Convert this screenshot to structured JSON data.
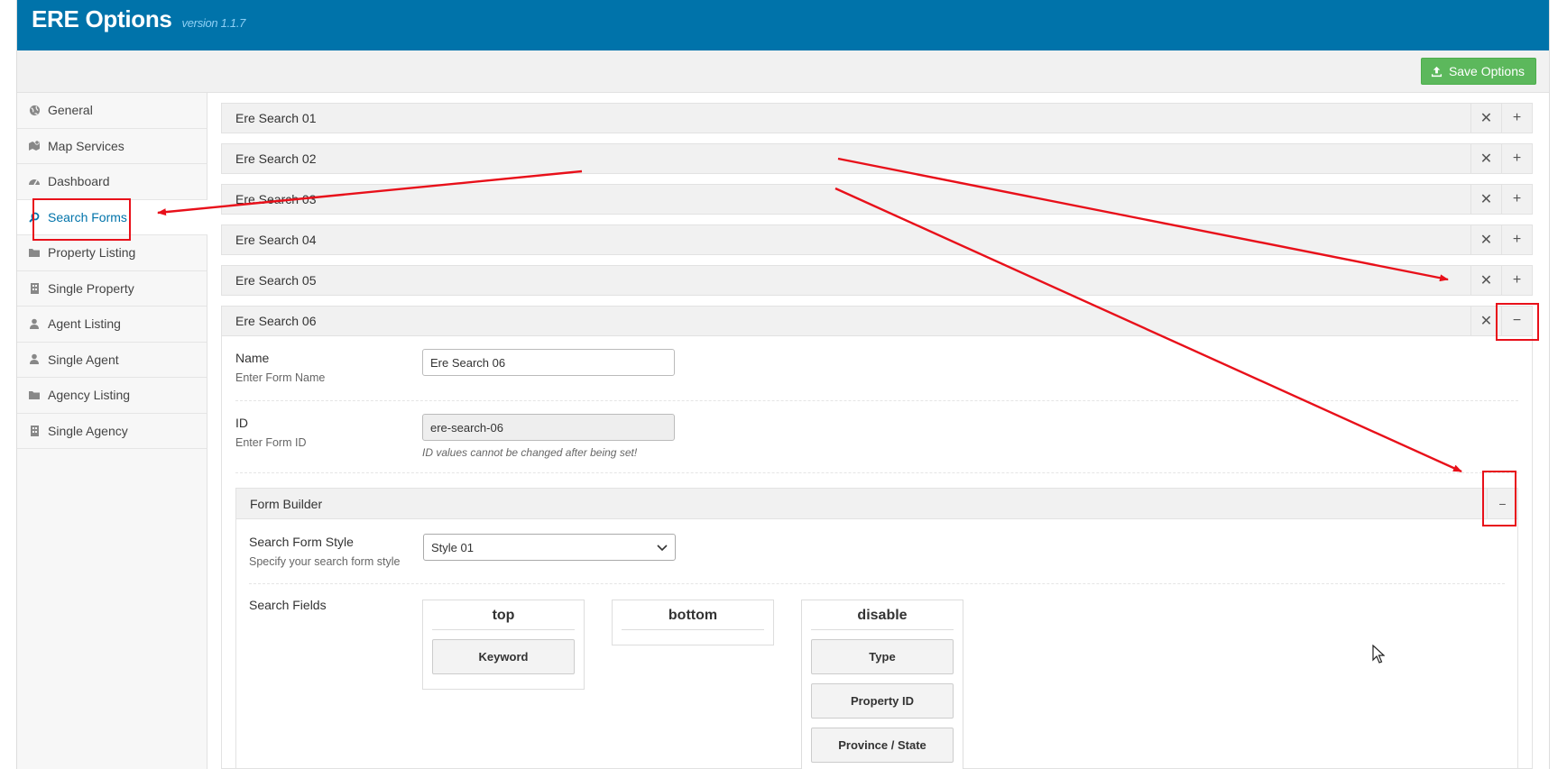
{
  "header": {
    "title": "ERE Options",
    "version": "version 1.1.7"
  },
  "toolbar": {
    "save_label": "Save Options"
  },
  "sidebar": {
    "items": [
      {
        "label": "General",
        "icon": "globe-icon"
      },
      {
        "label": "Map Services",
        "icon": "map-icon"
      },
      {
        "label": "Dashboard",
        "icon": "dashboard-icon"
      },
      {
        "label": "Search Forms",
        "icon": "search-icon",
        "active": true
      },
      {
        "label": "Property Listing",
        "icon": "folder-icon"
      },
      {
        "label": "Single Property",
        "icon": "building-icon"
      },
      {
        "label": "Agent Listing",
        "icon": "user-icon"
      },
      {
        "label": "Single Agent",
        "icon": "user-icon"
      },
      {
        "label": "Agency Listing",
        "icon": "folder-icon"
      },
      {
        "label": "Single Agency",
        "icon": "building-icon"
      }
    ]
  },
  "forms": [
    {
      "label": "Ere Search 01"
    },
    {
      "label": "Ere Search 02"
    },
    {
      "label": "Ere Search 03"
    },
    {
      "label": "Ere Search 04"
    },
    {
      "label": "Ere Search 05"
    },
    {
      "label": "Ere Search 06",
      "expanded": true
    }
  ],
  "expanded_form": {
    "name_label": "Name",
    "name_desc": "Enter Form Name",
    "name_value": "Ere Search 06",
    "id_label": "ID",
    "id_desc": "Enter Form ID",
    "id_value": "ere-search-06",
    "id_hint": "ID values cannot be changed after being set!",
    "builder": {
      "title": "Form Builder",
      "style_label": "Search Form Style",
      "style_desc": "Specify your search form style",
      "style_value": "Style 01",
      "fields_label": "Search Fields",
      "columns": [
        {
          "title": "top",
          "items": [
            "Keyword"
          ]
        },
        {
          "title": "bottom",
          "items": []
        },
        {
          "title": "disable",
          "items": [
            "Type",
            "Property ID",
            "Province / State"
          ]
        }
      ]
    }
  },
  "colors": {
    "header": "#0073aa",
    "save": "#5cb85c",
    "annotation": "#e8101a"
  }
}
